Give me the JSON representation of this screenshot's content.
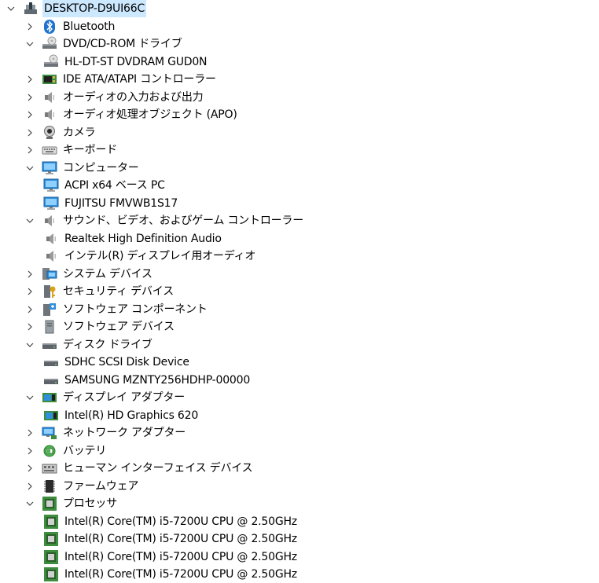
{
  "tree": [
    {
      "level": 0,
      "label": "DESKTOP-D9UI66C",
      "icon": "computer-root-icon",
      "state": "expanded",
      "selected": true
    },
    {
      "level": 1,
      "label": "Bluetooth",
      "icon": "bluetooth-icon",
      "state": "collapsed"
    },
    {
      "level": 1,
      "label": "DVD/CD-ROM ドライブ",
      "icon": "optical-drive-icon",
      "state": "expanded"
    },
    {
      "level": 2,
      "label": "HL-DT-ST DVDRAM GUD0N",
      "icon": "optical-drive-icon",
      "state": "leaf"
    },
    {
      "level": 1,
      "label": "IDE ATA/ATAPI コントローラー",
      "icon": "ide-controller-icon",
      "state": "collapsed"
    },
    {
      "level": 1,
      "label": "オーディオの入力および出力",
      "icon": "speaker-icon",
      "state": "collapsed"
    },
    {
      "level": 1,
      "label": "オーディオ処理オブジェクト (APO)",
      "icon": "speaker-icon",
      "state": "collapsed"
    },
    {
      "level": 1,
      "label": "カメラ",
      "icon": "camera-icon",
      "state": "collapsed"
    },
    {
      "level": 1,
      "label": "キーボード",
      "icon": "keyboard-icon",
      "state": "collapsed"
    },
    {
      "level": 1,
      "label": "コンピューター",
      "icon": "monitor-icon",
      "state": "expanded"
    },
    {
      "level": 2,
      "label": "ACPI x64 ベース PC",
      "icon": "monitor-icon",
      "state": "leaf"
    },
    {
      "level": 2,
      "label": "FUJITSU FMVWB1S17",
      "icon": "monitor-icon",
      "state": "leaf"
    },
    {
      "level": 1,
      "label": "サウンド、ビデオ、およびゲーム コントローラー",
      "icon": "speaker-icon",
      "state": "expanded"
    },
    {
      "level": 2,
      "label": "Realtek High Definition Audio",
      "icon": "speaker-icon",
      "state": "leaf"
    },
    {
      "level": 2,
      "label": "インテル(R) ディスプレイ用オーディオ",
      "icon": "speaker-icon",
      "state": "leaf"
    },
    {
      "level": 1,
      "label": "システム デバイス",
      "icon": "system-device-icon",
      "state": "collapsed"
    },
    {
      "level": 1,
      "label": "セキュリティ デバイス",
      "icon": "security-key-icon",
      "state": "collapsed"
    },
    {
      "level": 1,
      "label": "ソフトウェア コンポーネント",
      "icon": "software-component-icon",
      "state": "collapsed"
    },
    {
      "level": 1,
      "label": "ソフトウェア デバイス",
      "icon": "software-device-icon",
      "state": "collapsed"
    },
    {
      "level": 1,
      "label": "ディスク ドライブ",
      "icon": "disk-drive-icon",
      "state": "expanded"
    },
    {
      "level": 2,
      "label": "SDHC SCSI Disk Device",
      "icon": "disk-drive-icon",
      "state": "leaf"
    },
    {
      "level": 2,
      "label": "SAMSUNG MZNTY256HDHP-00000",
      "icon": "disk-drive-icon",
      "state": "leaf"
    },
    {
      "level": 1,
      "label": "ディスプレイ アダプター",
      "icon": "display-adapter-icon",
      "state": "expanded"
    },
    {
      "level": 2,
      "label": "Intel(R) HD Graphics 620",
      "icon": "display-adapter-icon",
      "state": "leaf"
    },
    {
      "level": 1,
      "label": "ネットワーク アダプター",
      "icon": "network-adapter-icon",
      "state": "collapsed"
    },
    {
      "level": 1,
      "label": "バッテリ",
      "icon": "battery-icon",
      "state": "collapsed"
    },
    {
      "level": 1,
      "label": "ヒューマン インターフェイス デバイス",
      "icon": "hid-icon",
      "state": "collapsed"
    },
    {
      "level": 1,
      "label": "ファームウェア",
      "icon": "firmware-icon",
      "state": "collapsed"
    },
    {
      "level": 1,
      "label": "プロセッサ",
      "icon": "processor-icon",
      "state": "expanded"
    },
    {
      "level": 2,
      "label": "Intel(R) Core(TM) i5-7200U CPU @ 2.50GHz",
      "icon": "processor-icon",
      "state": "leaf"
    },
    {
      "level": 2,
      "label": "Intel(R) Core(TM) i5-7200U CPU @ 2.50GHz",
      "icon": "processor-icon",
      "state": "leaf"
    },
    {
      "level": 2,
      "label": "Intel(R) Core(TM) i5-7200U CPU @ 2.50GHz",
      "icon": "processor-icon",
      "state": "leaf"
    },
    {
      "level": 2,
      "label": "Intel(R) Core(TM) i5-7200U CPU @ 2.50GHz",
      "icon": "processor-icon",
      "state": "leaf"
    }
  ],
  "colors": {
    "selection": "#cce8ff",
    "chevron": "#444444",
    "accent": "#0078d7"
  }
}
